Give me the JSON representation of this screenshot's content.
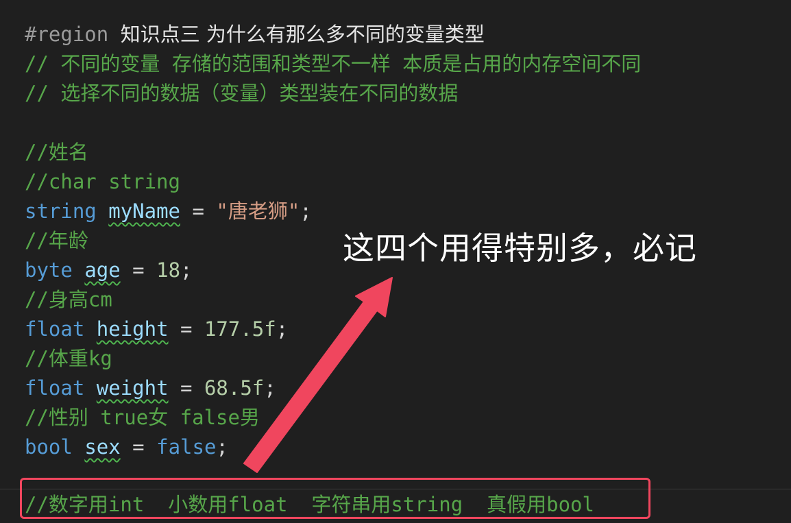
{
  "code": {
    "region_keyword": "#region",
    "region_title": "知识点三 为什么有那么多不同的变量类型",
    "comment_storage": "// 不同的变量 存储的范围和类型不一样 本质是占用的内存空间不同",
    "comment_choose": "// 选择不同的数据（变量）类型装在不同的数据",
    "comment_name": "//姓名",
    "comment_char_string": "//char string",
    "name_decl": {
      "type": "string",
      "ident": "myName",
      "op": "=",
      "value": "\"唐老狮\"",
      "end": ";"
    },
    "comment_age": "//年龄",
    "age_decl": {
      "type": "byte",
      "ident": "age",
      "op": "=",
      "value": "18",
      "end": ";"
    },
    "comment_height": "//身高cm",
    "height_decl": {
      "type": "float",
      "ident": "height",
      "op": "=",
      "value": "177.5f",
      "end": ";"
    },
    "comment_weight": "//体重kg",
    "weight_decl": {
      "type": "float",
      "ident": "weight",
      "op": "=",
      "value": "68.5f",
      "end": ";"
    },
    "comment_sex": "//性别 true女 false男",
    "sex_decl": {
      "type": "bool",
      "ident": "sex",
      "op": "=",
      "value": "false",
      "end": ";"
    },
    "summary_comment": "//数字用int  小数用float  字符串用string  真假用bool"
  },
  "annotation": {
    "text": "这四个用得特别多，必记",
    "arrow_color": "#f0465e",
    "box_color": "#f0465e"
  },
  "colors": {
    "background": "#1f1f1f",
    "comment": "#57a64a",
    "keyword": "#569cd6",
    "identifier": "#9cdcfe",
    "string": "#d69d85",
    "number": "#b5cea8"
  }
}
